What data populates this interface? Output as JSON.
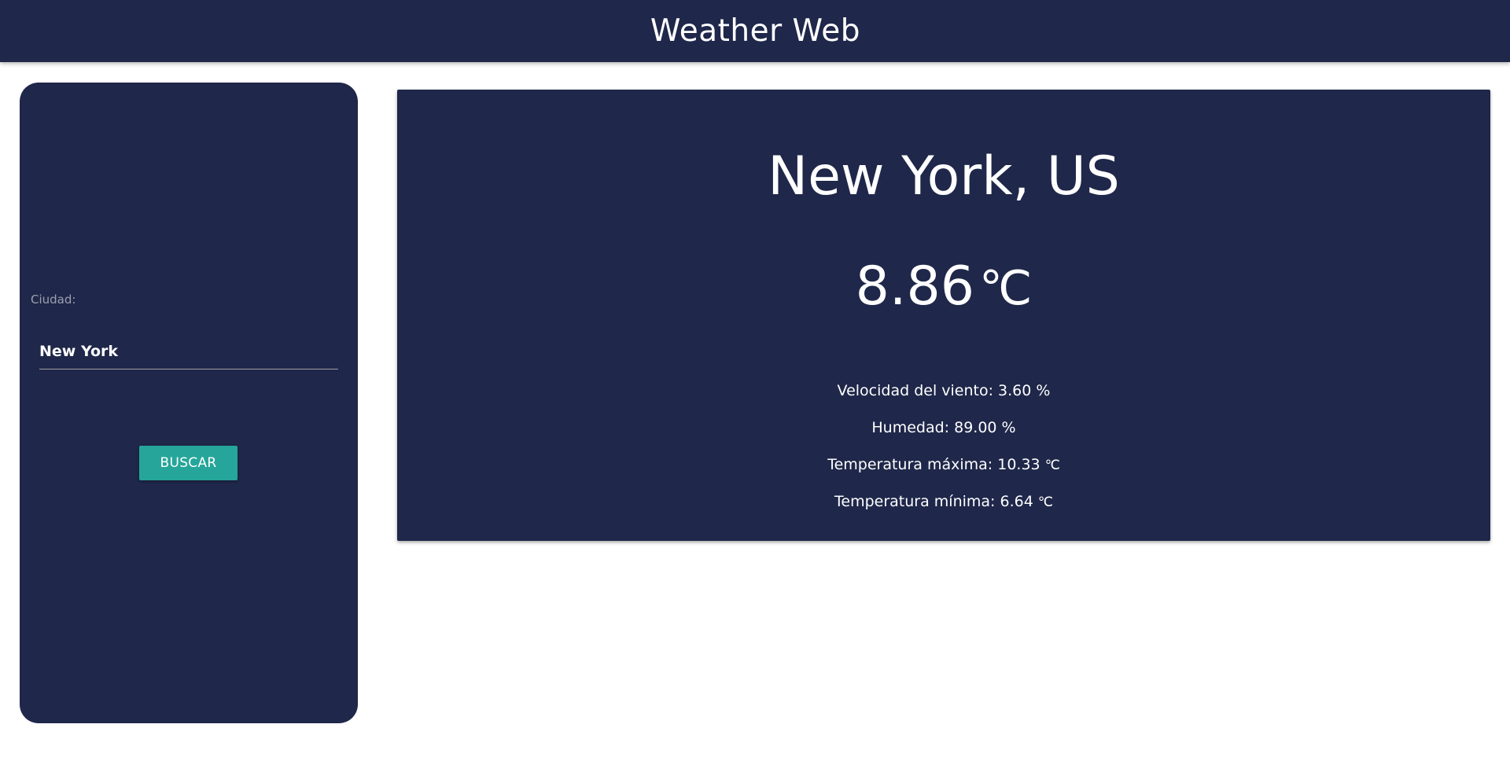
{
  "navbar": {
    "brand": "Weather Web"
  },
  "search": {
    "label": "Ciudad:",
    "value": "New York",
    "button_label": "BUSCAR"
  },
  "weather": {
    "location": "New York, US",
    "temperature": "8.86",
    "temperature_unit": "℃",
    "wind_label": "Velocidad del viento: 3.60 %",
    "humidity_label": "Humedad: 89.00 %",
    "max_temp_label": "Temperatura máxima: 10.33",
    "max_temp_unit": "℃",
    "min_temp_label": "Temperatura mínima: 6.64",
    "min_temp_unit": "℃"
  },
  "colors": {
    "navy": "#1f274a",
    "teal_button": "#26a69a",
    "white": "#ffffff",
    "label_gray": "#9aa0ae"
  }
}
